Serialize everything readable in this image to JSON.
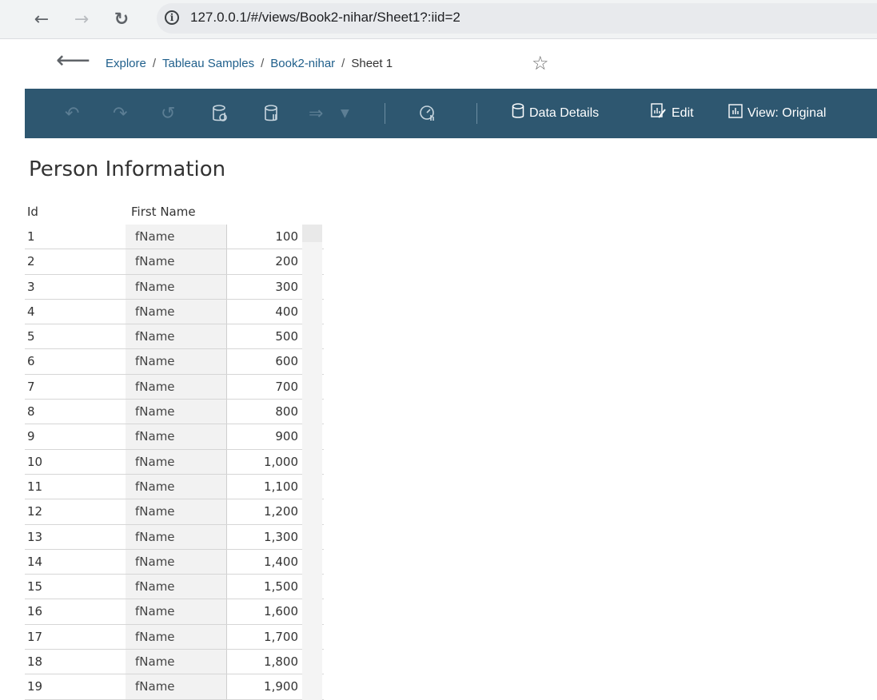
{
  "browser": {
    "url": "127.0.0.1/#/views/Book2-nihar/Sheet1?:iid=2"
  },
  "breadcrumb": {
    "items": [
      "Explore",
      "Tableau Samples",
      "Book2-nihar"
    ],
    "current": "Sheet 1",
    "separator": "/"
  },
  "toolbar": {
    "data_details_label": "Data Details",
    "edit_label": "Edit",
    "view_label": "View: Original"
  },
  "sheet": {
    "title": "Person Information",
    "columns": [
      "Id",
      "First Name",
      ""
    ],
    "rows": [
      [
        "1",
        "fName",
        "100"
      ],
      [
        "2",
        "fName",
        "200"
      ],
      [
        "3",
        "fName",
        "300"
      ],
      [
        "4",
        "fName",
        "400"
      ],
      [
        "5",
        "fName",
        "500"
      ],
      [
        "6",
        "fName",
        "600"
      ],
      [
        "7",
        "fName",
        "700"
      ],
      [
        "8",
        "fName",
        "800"
      ],
      [
        "9",
        "fName",
        "900"
      ],
      [
        "10",
        "fName",
        "1,000"
      ],
      [
        "11",
        "fName",
        "1,100"
      ],
      [
        "12",
        "fName",
        "1,200"
      ],
      [
        "13",
        "fName",
        "1,300"
      ],
      [
        "14",
        "fName",
        "1,400"
      ],
      [
        "15",
        "fName",
        "1,500"
      ],
      [
        "16",
        "fName",
        "1,600"
      ],
      [
        "17",
        "fName",
        "1,700"
      ],
      [
        "18",
        "fName",
        "1,800"
      ],
      [
        "19",
        "fName",
        "1,900"
      ]
    ]
  },
  "colors": {
    "toolbar_bg": "#2e5770",
    "link": "#1f5f8b"
  }
}
